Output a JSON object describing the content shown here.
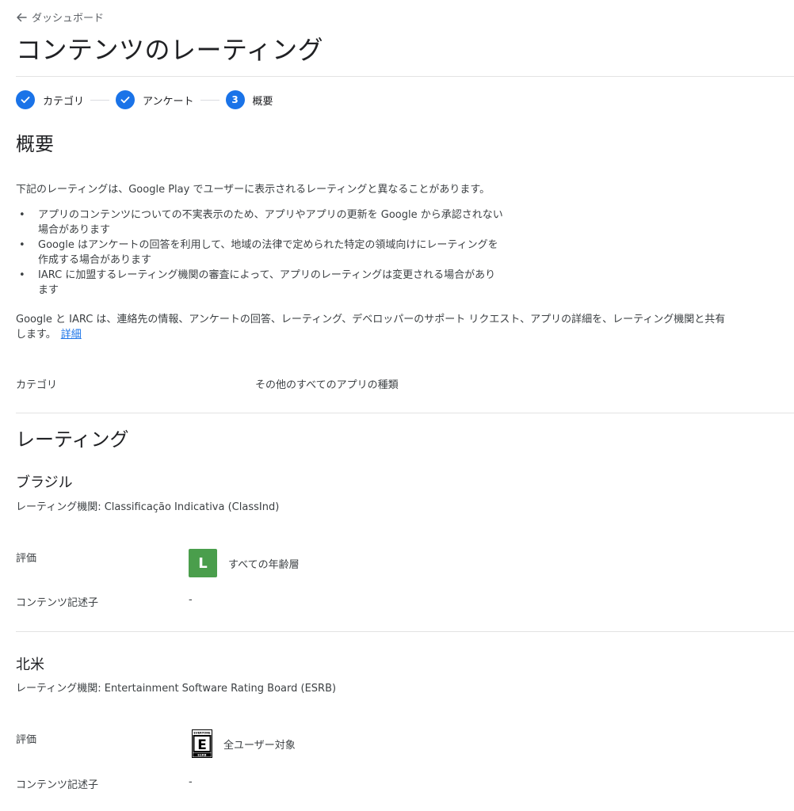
{
  "nav": {
    "back_label": "ダッシュボード"
  },
  "page": {
    "title": "コンテンツのレーティング"
  },
  "stepper": {
    "steps": [
      {
        "label": "カテゴリ",
        "state": "done"
      },
      {
        "label": "アンケート",
        "state": "done"
      },
      {
        "label": "概要",
        "state": "current",
        "number": "3"
      }
    ]
  },
  "summary": {
    "heading": "概要",
    "intro": "下記のレーティングは、Google Play でユーザーに表示されるレーティングと異なることがあります。",
    "bullets": [
      "アプリのコンテンツについての不実表示のため、アプリやアプリの更新を Google から承認されない場合があります",
      "Google はアンケートの回答を利用して、地域の法律で定められた特定の領域向けにレーティングを作成する場合があります",
      "IARC に加盟するレーティング機関の審査によって、アプリのレーティングは変更される場合があります"
    ],
    "share_text": "Google と IARC は、連絡先の情報、アンケートの回答、レーティング、デベロッパーのサポート リクエスト、アプリの詳細を、レーティング機関と共有します。",
    "details_link": "詳細",
    "category_label": "カテゴリ",
    "category_value": "その他のすべてのアプリの種類"
  },
  "ratings": {
    "heading": "レーティング",
    "regions": [
      {
        "name": "ブラジル",
        "authority": "レーティング機関: Classificação Indicativa (ClassInd)",
        "rating_label": "評価",
        "badge_text": "L",
        "badge_icon": "classind-l-badge",
        "badge_color": "#4a9e4c",
        "rating_value": "すべての年齢層",
        "descriptors_label": "コンテンツ記述子",
        "descriptors_value": "-"
      },
      {
        "name": "北米",
        "authority": "レーティング機関: Entertainment Software Rating Board (ESRB)",
        "rating_label": "評価",
        "badge_text": "E",
        "badge_top_text": "EVERYONE",
        "badge_bottom_text": "ESRB",
        "badge_icon": "esrb-e-badge",
        "rating_value": "全ユーザー対象",
        "descriptors_label": "コンテンツ記述子",
        "descriptors_value": "-"
      }
    ]
  },
  "colors": {
    "accent": "#1a73e8",
    "divider": "#e3e3e3",
    "text": "#202124"
  }
}
